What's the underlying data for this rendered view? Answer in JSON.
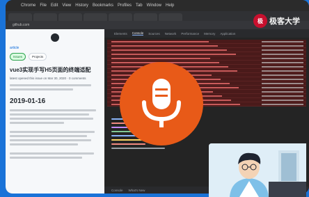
{
  "browser": {
    "app_name": "Chrome",
    "url_text": "github.com",
    "menu_items": [
      "Chrome",
      "File",
      "Edit",
      "View",
      "History",
      "Bookmarks",
      "Profiles",
      "Tab",
      "Window",
      "Help"
    ]
  },
  "left_page": {
    "small_link": "article",
    "pill_issues": "Issues",
    "pill_projects": "Projects",
    "title": "vue3实现手写H5页面的终端适配",
    "meta": "latest opened this issue on Mar 30, 2020 · 0 comments",
    "date_heading": "2019-01-16"
  },
  "devtools": {
    "tabs": [
      "Elements",
      "Console",
      "Sources",
      "Network",
      "Performance",
      "Memory",
      "Application"
    ],
    "active_tab": "Console",
    "bottom_tabs": [
      "Console",
      "What's New"
    ]
  },
  "overlay": {
    "icon": "microphone-icon",
    "accent_color": "#e85a18",
    "brand_badge": "极",
    "brand_name": "极客大学"
  }
}
